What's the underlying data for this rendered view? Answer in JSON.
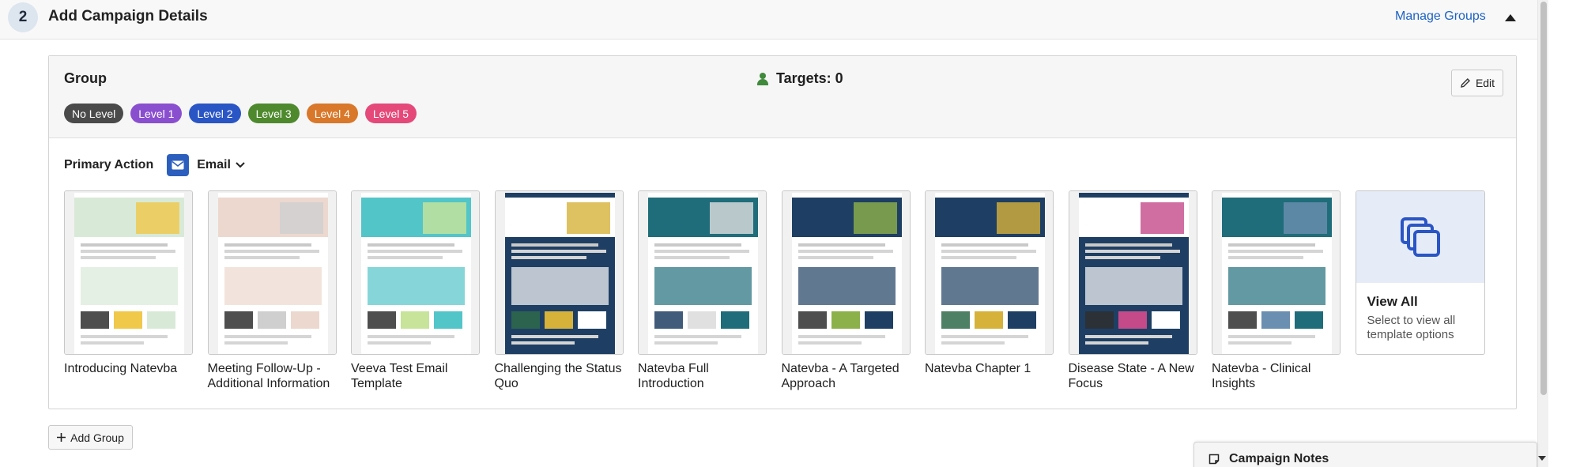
{
  "header": {
    "step_number": "2",
    "title": "Add Campaign Details",
    "manage_groups_label": "Manage Groups"
  },
  "group": {
    "title": "Group",
    "targets_label": "Targets: 0",
    "edit_label": "Edit",
    "levels": [
      {
        "label": "No Level",
        "color": "#4a4a4a"
      },
      {
        "label": "Level 1",
        "color": "#8a4fcf"
      },
      {
        "label": "Level 2",
        "color": "#2a55c5"
      },
      {
        "label": "Level 3",
        "color": "#4e8a2d"
      },
      {
        "label": "Level 4",
        "color": "#d9782a"
      },
      {
        "label": "Level 5",
        "color": "#e4497a"
      }
    ],
    "primary_action": {
      "label": "Primary Action",
      "channel": "Email"
    },
    "templates": [
      {
        "name": "Introducing Natevba"
      },
      {
        "name": "Meeting Follow-Up - Additional Information"
      },
      {
        "name": "Veeva Test Email Template"
      },
      {
        "name": "Challenging the Status Quo"
      },
      {
        "name": "Natevba Full Introduction"
      },
      {
        "name": "Natevba - A Targeted Approach"
      },
      {
        "name": "Natevba Chapter 1"
      },
      {
        "name": "Disease State - A New Focus"
      },
      {
        "name": "Natevba - Clinical Insights"
      }
    ],
    "view_all": {
      "title": "View All",
      "subtitle": "Select to view all template options"
    }
  },
  "add_group_label": "Add Group",
  "campaign_notes_label": "Campaign Notes",
  "colors": {
    "accent": "#1d62c4",
    "email_icon_bg": "#2c5fbd",
    "targets_icon": "#3f8a3b"
  }
}
